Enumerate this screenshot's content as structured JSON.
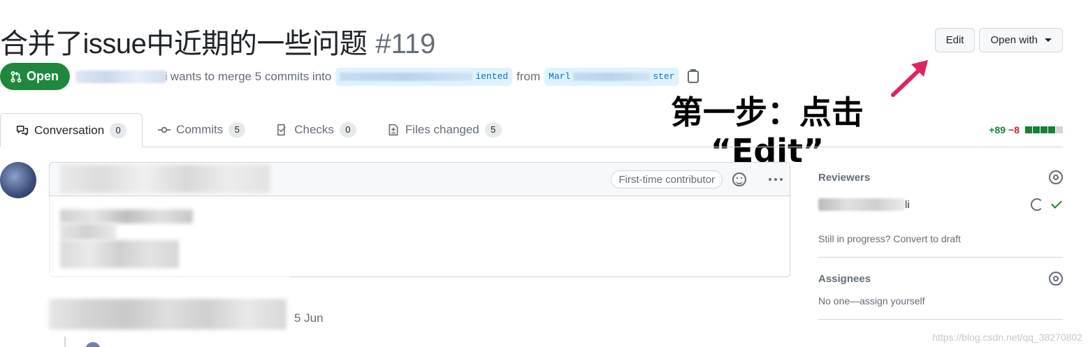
{
  "header": {
    "title": "合并了issue中近期的一些问题",
    "number": "#119",
    "edit_label": "Edit",
    "open_with_label": "Open with"
  },
  "state": {
    "badge_label": "Open",
    "author_suffix": "i",
    "merge_text": "wants to merge 5 commits into",
    "base_branch_suffix": "iented",
    "from_text": "from",
    "head_branch_prefix": "Marl",
    "head_branch_suffix": "ster"
  },
  "annotation": {
    "line1": "第一步：点击",
    "line2": "“Edit”",
    "arrow_color": "#e0245e"
  },
  "tabs": [
    {
      "label": "Conversation",
      "count": "0"
    },
    {
      "label": "Commits",
      "count": "5"
    },
    {
      "label": "Checks",
      "count": "0"
    },
    {
      "label": "Files changed",
      "count": "5"
    }
  ],
  "diffstat": {
    "additions": "+89",
    "deletions": "−8"
  },
  "comment": {
    "contributor_badge": "First-time contributor",
    "date": "5 Jun"
  },
  "sidebar": {
    "reviewers_heading": "Reviewers",
    "reviewer_suffix": "li",
    "draft_text": "Still in progress? Convert to draft",
    "assignees_heading": "Assignees",
    "assignees_text": "No one—assign yourself"
  },
  "watermark": "https://blog.csdn.net/qq_38270802",
  "colors": {
    "open_green": "#1f883d",
    "add_green": "#1a7f37",
    "del_red": "#cf222e",
    "branch_bg": "#ddf4ff",
    "branch_fg": "#0969da"
  }
}
